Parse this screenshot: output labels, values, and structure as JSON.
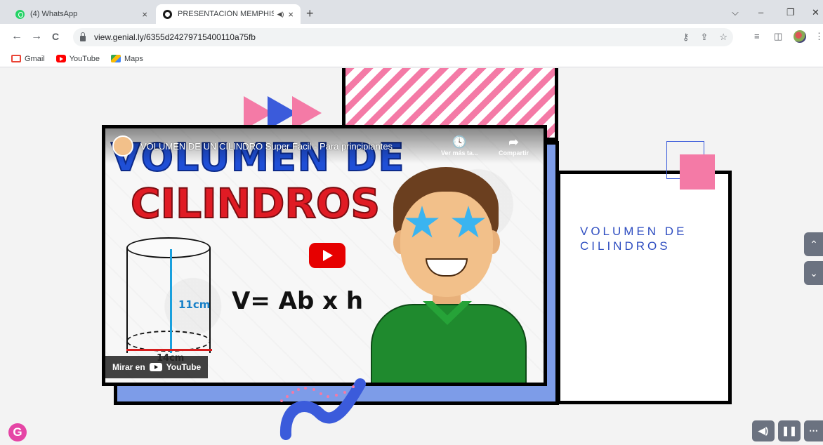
{
  "browser": {
    "tabs": [
      {
        "title": "(4) WhatsApp",
        "active": false
      },
      {
        "title": "PRESENTACIÓN MEMPHIS",
        "active": true
      }
    ],
    "new_tab": "+",
    "close_glyph": "×",
    "audio_glyph": "◀)",
    "window_controls": {
      "dropdown": "⌵",
      "minimize": "–",
      "restore": "❐",
      "close": "✕"
    },
    "url": "view.genial.ly/6355d24279715400110a75fb",
    "nav": {
      "back": "←",
      "forward": "→",
      "reload": "C"
    },
    "toolbar_icons": {
      "key": "⚷",
      "share": "⇪",
      "star": "☆",
      "media": "≡",
      "sidebar": "◫",
      "menu": "⋮"
    }
  },
  "bookmarks": [
    {
      "label": "Gmail",
      "icon": "gmail-icon"
    },
    {
      "label": "YouTube",
      "icon": "youtube-icon"
    },
    {
      "label": "Maps",
      "icon": "maps-icon"
    }
  ],
  "slide": {
    "title": "VOLUMEN DE CILINDROS",
    "colors": {
      "pink": "#f47aa6",
      "blue": "#3b5bdb",
      "periwinkle": "#7d9ce8",
      "title": "#2f4ec1"
    }
  },
  "video": {
    "title": "VOLUMEN DE UN CILINDRO Super Facil - Para principiantes",
    "actions": [
      {
        "label": "Ver más ta...",
        "icon": "clock-icon",
        "glyph": "🕓"
      },
      {
        "label": "Compartir",
        "icon": "share-icon",
        "glyph": "➦"
      }
    ],
    "watch_on": "Mirar en",
    "watch_on_brand": "YouTube",
    "thumbnail": {
      "line1": "VOLUMEN DE",
      "line2": "CILINDROS",
      "formula": "V= Ab x h",
      "height_label": "11cm",
      "radius_label": "14cm"
    }
  },
  "presentation_controls": {
    "up": "⌃",
    "down": "⌄",
    "audio": "◀)",
    "pause": "❚❚",
    "more": "⋯",
    "logo": "G"
  }
}
